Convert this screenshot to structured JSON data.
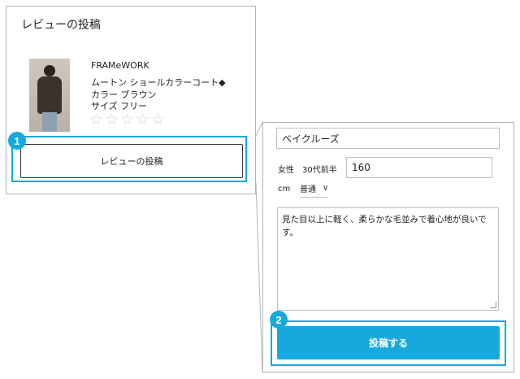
{
  "card": {
    "title": "レビューの投稿",
    "brand": "FRAMeWORK",
    "product_name": "ムートン ショールカラーコート◆",
    "color_line": "カラー ブラウン",
    "size_line": "サイズ フリー",
    "rating": 0,
    "rating_max": 5,
    "button_label": "レビューの投稿"
  },
  "steps": {
    "step1": "1",
    "step2": "2"
  },
  "form": {
    "nickname_value": "ベイクルーズ",
    "gender_age": "女性　30代前半",
    "height_value": "160",
    "height_unit": "cm",
    "fit_value": "普通",
    "review_text": "見た目以上に軽く、柔らかな毛並みで着心地が良いです。",
    "submit_label": "投稿する"
  },
  "colors": {
    "accent": "#17a9dd",
    "star_empty": "#d4d4d4",
    "border": "#b5b5b5"
  }
}
